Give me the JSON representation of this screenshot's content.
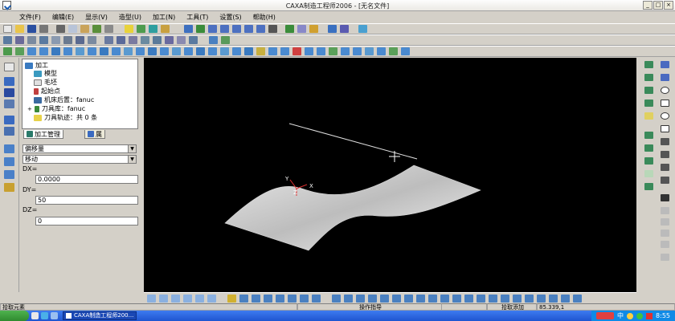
{
  "window": {
    "title": "CAXA制造工程师2006 - [无名文件]",
    "min": "_",
    "max": "□",
    "close": "×"
  },
  "menu": [
    "文件(F)",
    "编辑(E)",
    "显示(V)",
    "造型(U)",
    "加工(N)",
    "工具(T)",
    "设置(S)",
    "帮助(H)"
  ],
  "tree": {
    "root": "加工",
    "items": [
      "模型",
      "毛坯",
      "起始点",
      "机床后置：fanuc",
      "刀具库：fanuc",
      "刀具轨迹：共 0 条"
    ],
    "expander": "+"
  },
  "tabs": {
    "manage": "加工管理",
    "attr": "属"
  },
  "props": {
    "combo1": "偏移量",
    "combo2": "移动",
    "dx_label": "DX=",
    "dx_value": "0.0000",
    "dy_label": "DY=",
    "dy_value": "50",
    "dz_label": "DZ=",
    "dz_value": "0"
  },
  "viewport": {
    "axis_x": "X",
    "axis_y": "Y",
    "axis_z": "Z"
  },
  "status": {
    "left": "拾取元素",
    "middle": "操作指导",
    "right1": "拾取添加",
    "coords": "85.339,1"
  },
  "taskbar": {
    "app_item": "CAXA制造工程师200...",
    "ime": "中",
    "clock": "8:55"
  },
  "colors": {
    "taskbar": "#2a62e0",
    "viewport": "#000000",
    "surface": "#c9c9c9"
  }
}
